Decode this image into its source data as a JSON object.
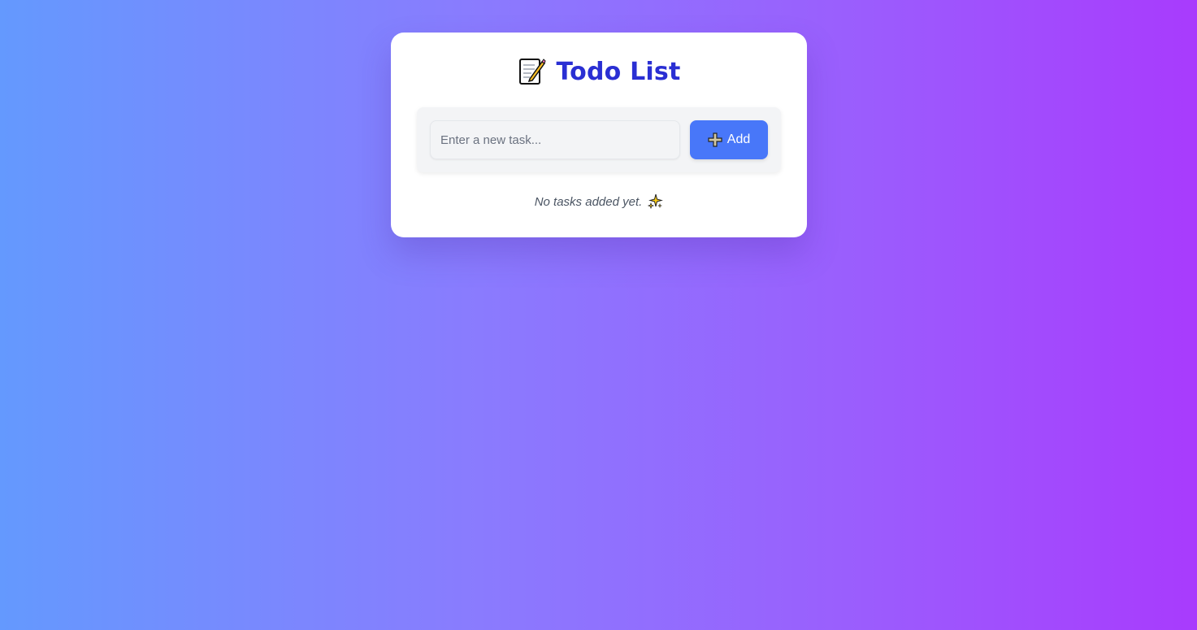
{
  "app": {
    "title": "Todo List",
    "title_icon": "memo-icon"
  },
  "form": {
    "input_placeholder": "Enter a new task...",
    "input_value": "",
    "add_label": "Add",
    "add_icon": "plus-icon"
  },
  "list": {
    "empty_message": "No tasks added yet.",
    "empty_icon": "sparkle-icon"
  },
  "colors": {
    "title": "#2a2fd3",
    "button": "#4877f9",
    "gradient_start": "#6499fe",
    "gradient_end": "#a83bfd"
  }
}
